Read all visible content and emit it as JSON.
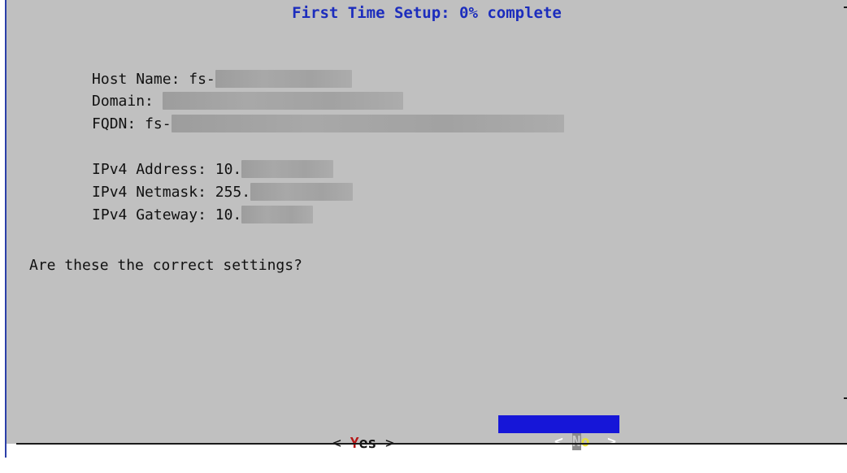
{
  "dialog": {
    "title": "First Time Setup: 0% complete",
    "question": "Are these the correct settings?"
  },
  "fields": {
    "host_name": {
      "label": "Host Name: ",
      "value_prefix": "fs-"
    },
    "domain": {
      "label": "Domain: ",
      "value_prefix": ""
    },
    "fqdn": {
      "label": "FQDN: ",
      "value_prefix": "fs-"
    },
    "ipv4_address": {
      "label": "IPv4 Address: ",
      "value_prefix": "10."
    },
    "ipv4_netmask": {
      "label": "IPv4 Netmask: ",
      "value_prefix": "255."
    },
    "ipv4_gateway": {
      "label": "IPv4 Gateway: ",
      "value_prefix": "10."
    }
  },
  "buttons": {
    "yes": {
      "open": "< ",
      "hotkey": "Y",
      "rest": "es",
      "close": " >"
    },
    "no": {
      "open": "< ",
      "hotkey": "N",
      "rest": "o",
      "close": "  >"
    },
    "selected": "no"
  },
  "colors": {
    "background": "#c0c0c0",
    "title": "#1c2dbd",
    "hotkey": "#b51515",
    "selected_button_bg": "#1616d8",
    "selected_button_text": "#e6e03a"
  }
}
